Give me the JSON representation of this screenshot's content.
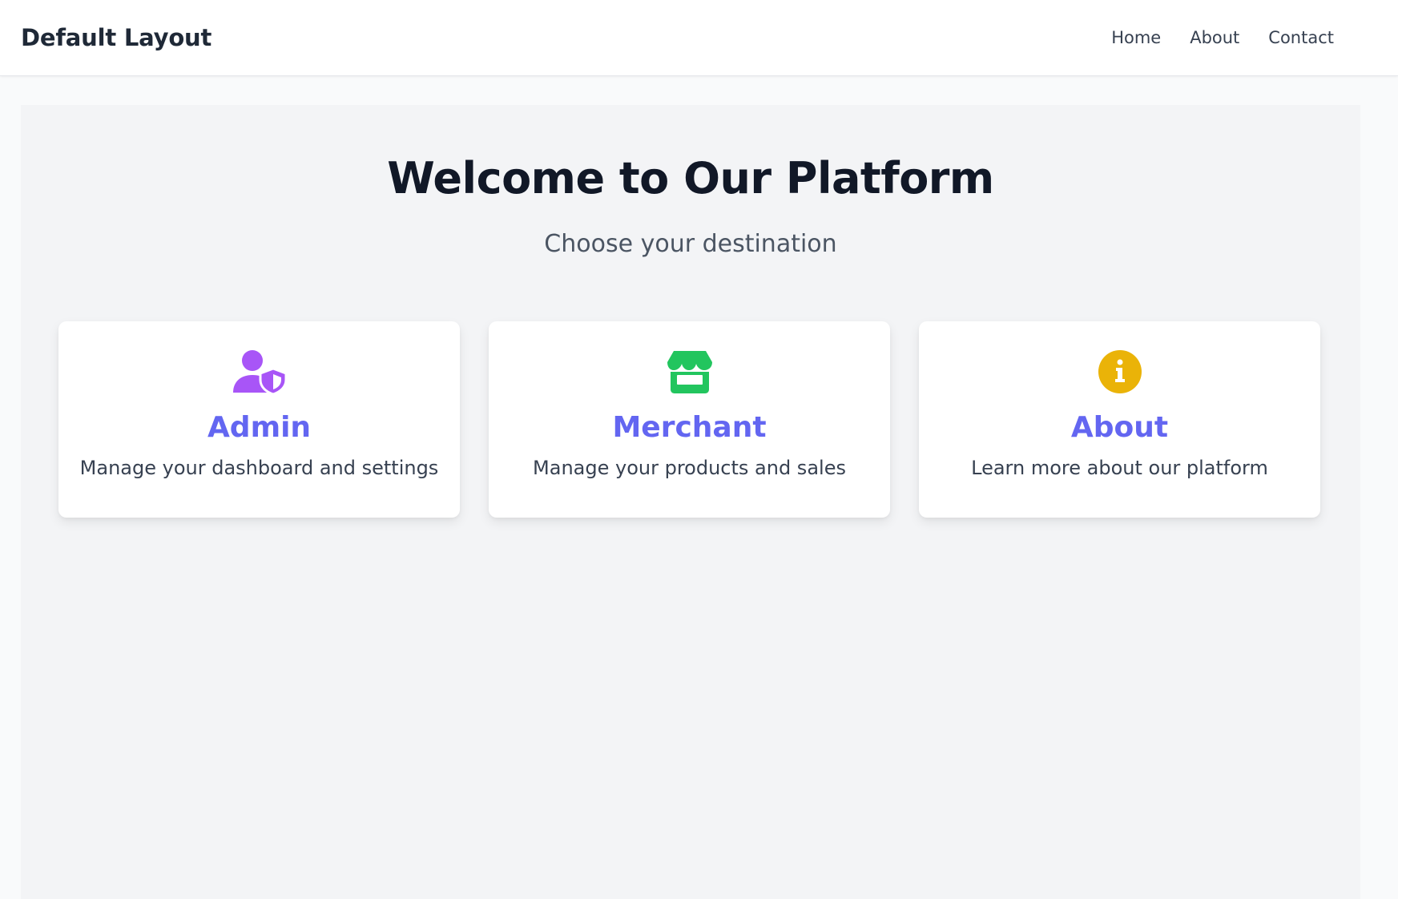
{
  "header": {
    "brand": "Default Layout",
    "nav": [
      {
        "label": "Home"
      },
      {
        "label": "About"
      },
      {
        "label": "Contact"
      }
    ]
  },
  "hero": {
    "title": "Welcome to Our Platform",
    "subtitle": "Choose your destination"
  },
  "cards": [
    {
      "icon": "user-shield-icon",
      "icon_color": "#a855f7",
      "title": "Admin",
      "description": "Manage your dashboard and settings"
    },
    {
      "icon": "store-icon",
      "icon_color": "#22c55e",
      "title": "Merchant",
      "description": "Manage your products and sales"
    },
    {
      "icon": "info-circle-icon",
      "icon_color": "#eab308",
      "title": "About",
      "description": "Learn more about our platform"
    }
  ],
  "colors": {
    "accent": "#6366f1",
    "heading": "#111827",
    "page_bg": "#f3f4f6"
  }
}
